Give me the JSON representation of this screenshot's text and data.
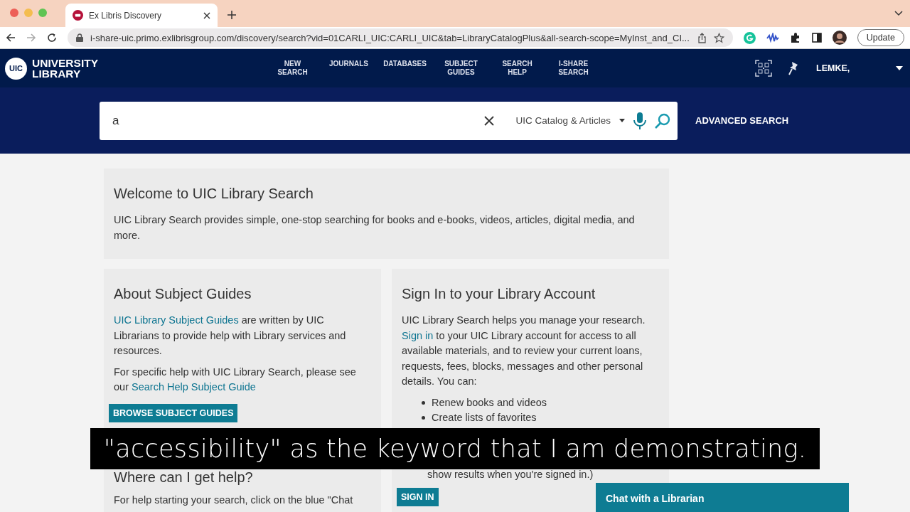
{
  "browser": {
    "tab_title": "Ex Libris Discovery",
    "url": "i-share-uic.primo.exlibrisgroup.com/discovery/search?vid=01CARLI_UIC:CARLI_UIC&tab=LibraryCatalogPlus&all-search-scope=MyInst_and_CI...",
    "update_button": "Update"
  },
  "header": {
    "logo_badge": "UIC",
    "logo_lines": [
      "UNIVERSITY",
      "LIBRARY"
    ],
    "nav": [
      {
        "lines": [
          "NEW",
          "SEARCH"
        ]
      },
      {
        "lines": [
          "JOURNALS"
        ]
      },
      {
        "lines": [
          "DATABASES"
        ]
      },
      {
        "lines": [
          "SUBJECT",
          "GUIDES"
        ]
      },
      {
        "lines": [
          "SEARCH",
          "HELP"
        ]
      },
      {
        "lines": [
          "I-SHARE",
          "SEARCH"
        ]
      }
    ],
    "user": "LEMKE,"
  },
  "search": {
    "value": "a",
    "scope": "UIC Catalog & Articles",
    "advanced": "ADVANCED SEARCH"
  },
  "welcome": {
    "title": "Welcome to UIC Library Search",
    "text": "UIC Library Search provides simple, one-stop searching for books and e-books, videos, articles, digital media, and more."
  },
  "guides": {
    "title": "About Subject Guides",
    "paragraphs": [
      [
        {
          "text": "UIC Library Subject Guides",
          "kind": "link"
        },
        {
          "text": " are written by UIC Librarians to provide help with Library services and resources.",
          "kind": "text"
        }
      ],
      [
        {
          "text": "For specific help with UIC Library Search, please see our ",
          "kind": "text"
        },
        {
          "text": "Search Help Subject Guide",
          "kind": "link"
        }
      ]
    ],
    "button": "BROWSE SUBJECT GUIDES"
  },
  "help": {
    "title": "Where can I get help?",
    "text": "For help starting your search, click on the blue \"Chat"
  },
  "account": {
    "title": "Sign In to your Library Account",
    "paragraph": [
      {
        "text": "UIC Library Search helps you manage your research. ",
        "kind": "text"
      },
      {
        "text": "Sign in",
        "kind": "link"
      },
      {
        "text": " to your UIC Library account for access to all available materials, and to review your current loans, requests, fees, blocks, messages and other personal details. You can:",
        "kind": "text"
      }
    ],
    "bullets": [
      "Renew books and videos",
      "Create lists of favorites"
    ],
    "note": "show results when you're signed in.)",
    "button": "SIGN IN"
  },
  "caption": "\"accessibility\" as the keyword that I am demonstrating.",
  "chat": "Chat with a Librarian"
}
